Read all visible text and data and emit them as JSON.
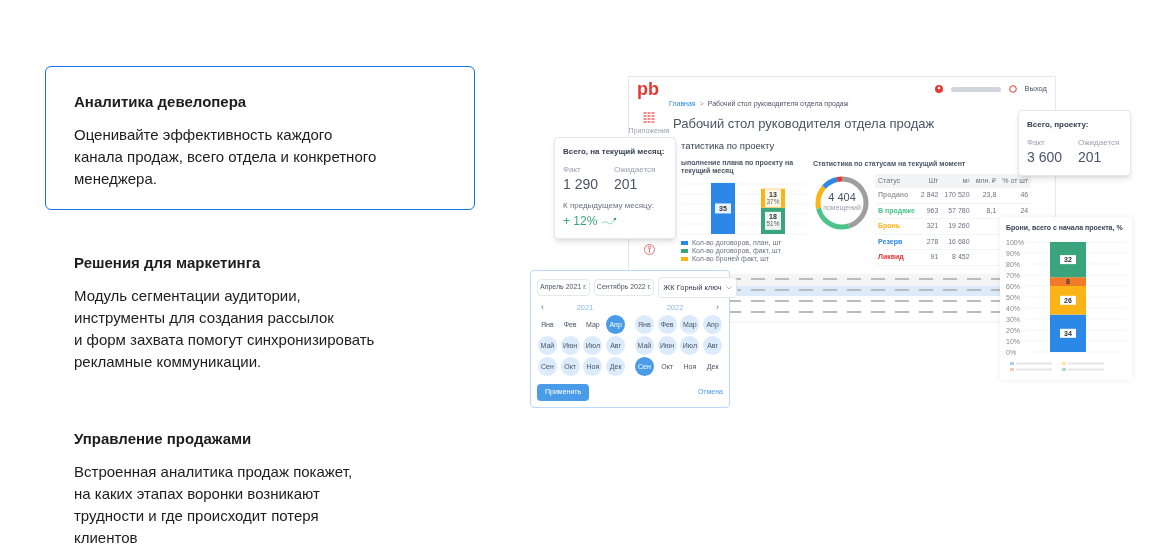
{
  "features": [
    {
      "title": "Аналитика девелопера",
      "lines": [
        "Оценивайте эффективность каждого",
        "канала продаж, всего отдела и конкретного",
        "менеджера."
      ],
      "selected": true
    },
    {
      "title": "Решения для маркетинга",
      "lines": [
        "Модуль сегментации аудитории,",
        "инструменты для создания рассылок",
        "и форм захвата помогут синхронизировать",
        "рекламные коммуникации."
      ],
      "selected": false
    },
    {
      "title": "Управление продажами",
      "lines": [
        "Встроенная аналитика продаж покажет,",
        "на каких этапах воронки возникают",
        "трудности и где происходит потеря",
        "клиентов"
      ],
      "selected": false
    }
  ],
  "dashboard": {
    "logo": "pb",
    "logout": "Выход",
    "sidebar_label": "Приложения",
    "breadcrumb": [
      "Главная",
      "Рабочий стол руководителя отдела продаж"
    ],
    "breadcrumb_separator": ">",
    "title": "Рабочий стол руководителя отдела продаж",
    "section": "татистика по проекту",
    "plan_chart": {
      "chart_data": {
        "type": "bar",
        "title": "ыполнение плана по проекту на текущий месяц",
        "stacked": true,
        "data_labels": true,
        "ylim": [
          0,
          37
        ],
        "series": [
          {
            "name": "Кол-во договоров, план, шт",
            "color": "#2b88e6",
            "values": [
              35,
              null
            ]
          },
          {
            "name": "Кол-во договоров, факт, шт",
            "color": "#3aa57d",
            "values": [
              null,
              18
            ]
          },
          {
            "name": "Кол-во броней факт, шт",
            "color": "#fbb316",
            "values": [
              null,
              13
            ]
          }
        ],
        "annotations": [
          {
            "text": "51%",
            "y": 9
          },
          {
            "text": "37%",
            "y": 24.5
          }
        ]
      }
    },
    "status_chart": {
      "title": "Статистика по статусам на текущий момент",
      "total": "4 404",
      "total_label": "помещений",
      "columns": [
        "Статус",
        "Шт",
        "м²",
        "млн. ₽",
        "% от шт"
      ],
      "rows": [
        {
          "color": "#9e9e9e",
          "cells": [
            "Продано",
            "2 842",
            "170 520",
            "23,8",
            "46"
          ]
        },
        {
          "color": "#4cc38a",
          "cells": [
            "В продаже",
            "963",
            "57 780",
            "8,1",
            "24"
          ]
        },
        {
          "color": "#fbb316",
          "cells": [
            "Бронь",
            "321",
            "19 260"
          ]
        },
        {
          "color": "#2b88e6",
          "cells": [
            "Резерв",
            "278",
            "16 680"
          ]
        },
        {
          "color": "#e53935",
          "cells": [
            "Ликвид",
            "91",
            "8 452"
          ]
        }
      ]
    }
  },
  "month_card": {
    "title": "Всего, на текущий месяц:",
    "fact_label": "Факт",
    "fact": "1 290",
    "expected_label": "Ожидается",
    "expected": "201",
    "compare_label": "К предыдущему месяцу:",
    "change": "+ 12%"
  },
  "project_card": {
    "title": "Всего, проекту:",
    "fact_label": "Факт",
    "fact": "3 600",
    "expected_label": "Ожидается",
    "expected": "201"
  },
  "picker": {
    "from": "Апрель 2021 г.",
    "to": "Сентябрь 2022 г.",
    "project": "ЖК Горный ключ",
    "prev": "‹",
    "next": "›",
    "years": [
      {
        "year": "2021",
        "months": [
          {
            "label": "Янв",
            "selected": false,
            "in_range": false
          },
          {
            "label": "Фев",
            "selected": false,
            "in_range": false
          },
          {
            "label": "Мар",
            "selected": false,
            "in_range": false
          },
          {
            "label": "Апр",
            "selected": true,
            "in_range": false
          },
          {
            "label": "Май",
            "selected": false,
            "in_range": true
          },
          {
            "label": "Июн",
            "selected": false,
            "in_range": true
          },
          {
            "label": "Июл",
            "selected": false,
            "in_range": true
          },
          {
            "label": "Авг",
            "selected": false,
            "in_range": true
          },
          {
            "label": "Сен",
            "selected": false,
            "in_range": true
          },
          {
            "label": "Окт",
            "selected": false,
            "in_range": true
          },
          {
            "label": "Ноя",
            "selected": false,
            "in_range": true
          },
          {
            "label": "Дек",
            "selected": false,
            "in_range": true
          }
        ]
      },
      {
        "year": "2022",
        "months": [
          {
            "label": "Янв",
            "selected": false,
            "in_range": true
          },
          {
            "label": "Фев",
            "selected": false,
            "in_range": true
          },
          {
            "label": "Мар",
            "selected": false,
            "in_range": true
          },
          {
            "label": "Апр",
            "selected": false,
            "in_range": true
          },
          {
            "label": "Май",
            "selected": false,
            "in_range": true
          },
          {
            "label": "Июн",
            "selected": false,
            "in_range": true
          },
          {
            "label": "Июл",
            "selected": false,
            "in_range": true
          },
          {
            "label": "Авг",
            "selected": false,
            "in_range": true
          },
          {
            "label": "Сен",
            "selected": true,
            "in_range": false
          },
          {
            "label": "Окт",
            "selected": false,
            "in_range": false
          },
          {
            "label": "Ноя",
            "selected": false,
            "in_range": false
          },
          {
            "label": "Дек",
            "selected": false,
            "in_range": false
          }
        ]
      }
    ],
    "apply": "Применить",
    "cancel": "Отмена"
  },
  "bookings_chart": {
    "chart_data": {
      "type": "bar",
      "title": "Брони, всего с начала проекта, %",
      "stacked": true,
      "data_labels": true,
      "ylim": [
        0,
        100
      ],
      "yticks": [
        {
          "value": 0,
          "label": "0%"
        },
        {
          "value": 10,
          "label": "10%"
        },
        {
          "value": 20,
          "label": "20%"
        },
        {
          "value": 30,
          "label": "30%"
        },
        {
          "value": 40,
          "label": "40%"
        },
        {
          "value": 50,
          "label": "50%"
        },
        {
          "value": 60,
          "label": "60%"
        },
        {
          "value": 70,
          "label": "70%"
        },
        {
          "value": 80,
          "label": "80%"
        },
        {
          "value": 90,
          "label": "90%"
        },
        {
          "value": 100,
          "label": "100%"
        }
      ],
      "series": [
        {
          "color": "#2b88e6",
          "values": [
            34
          ]
        },
        {
          "color": "#fbb316",
          "values": [
            26
          ]
        },
        {
          "color": "#f07a2a",
          "values": [
            8
          ]
        },
        {
          "color": "#3aa57d",
          "values": [
            32
          ]
        }
      ]
    }
  }
}
